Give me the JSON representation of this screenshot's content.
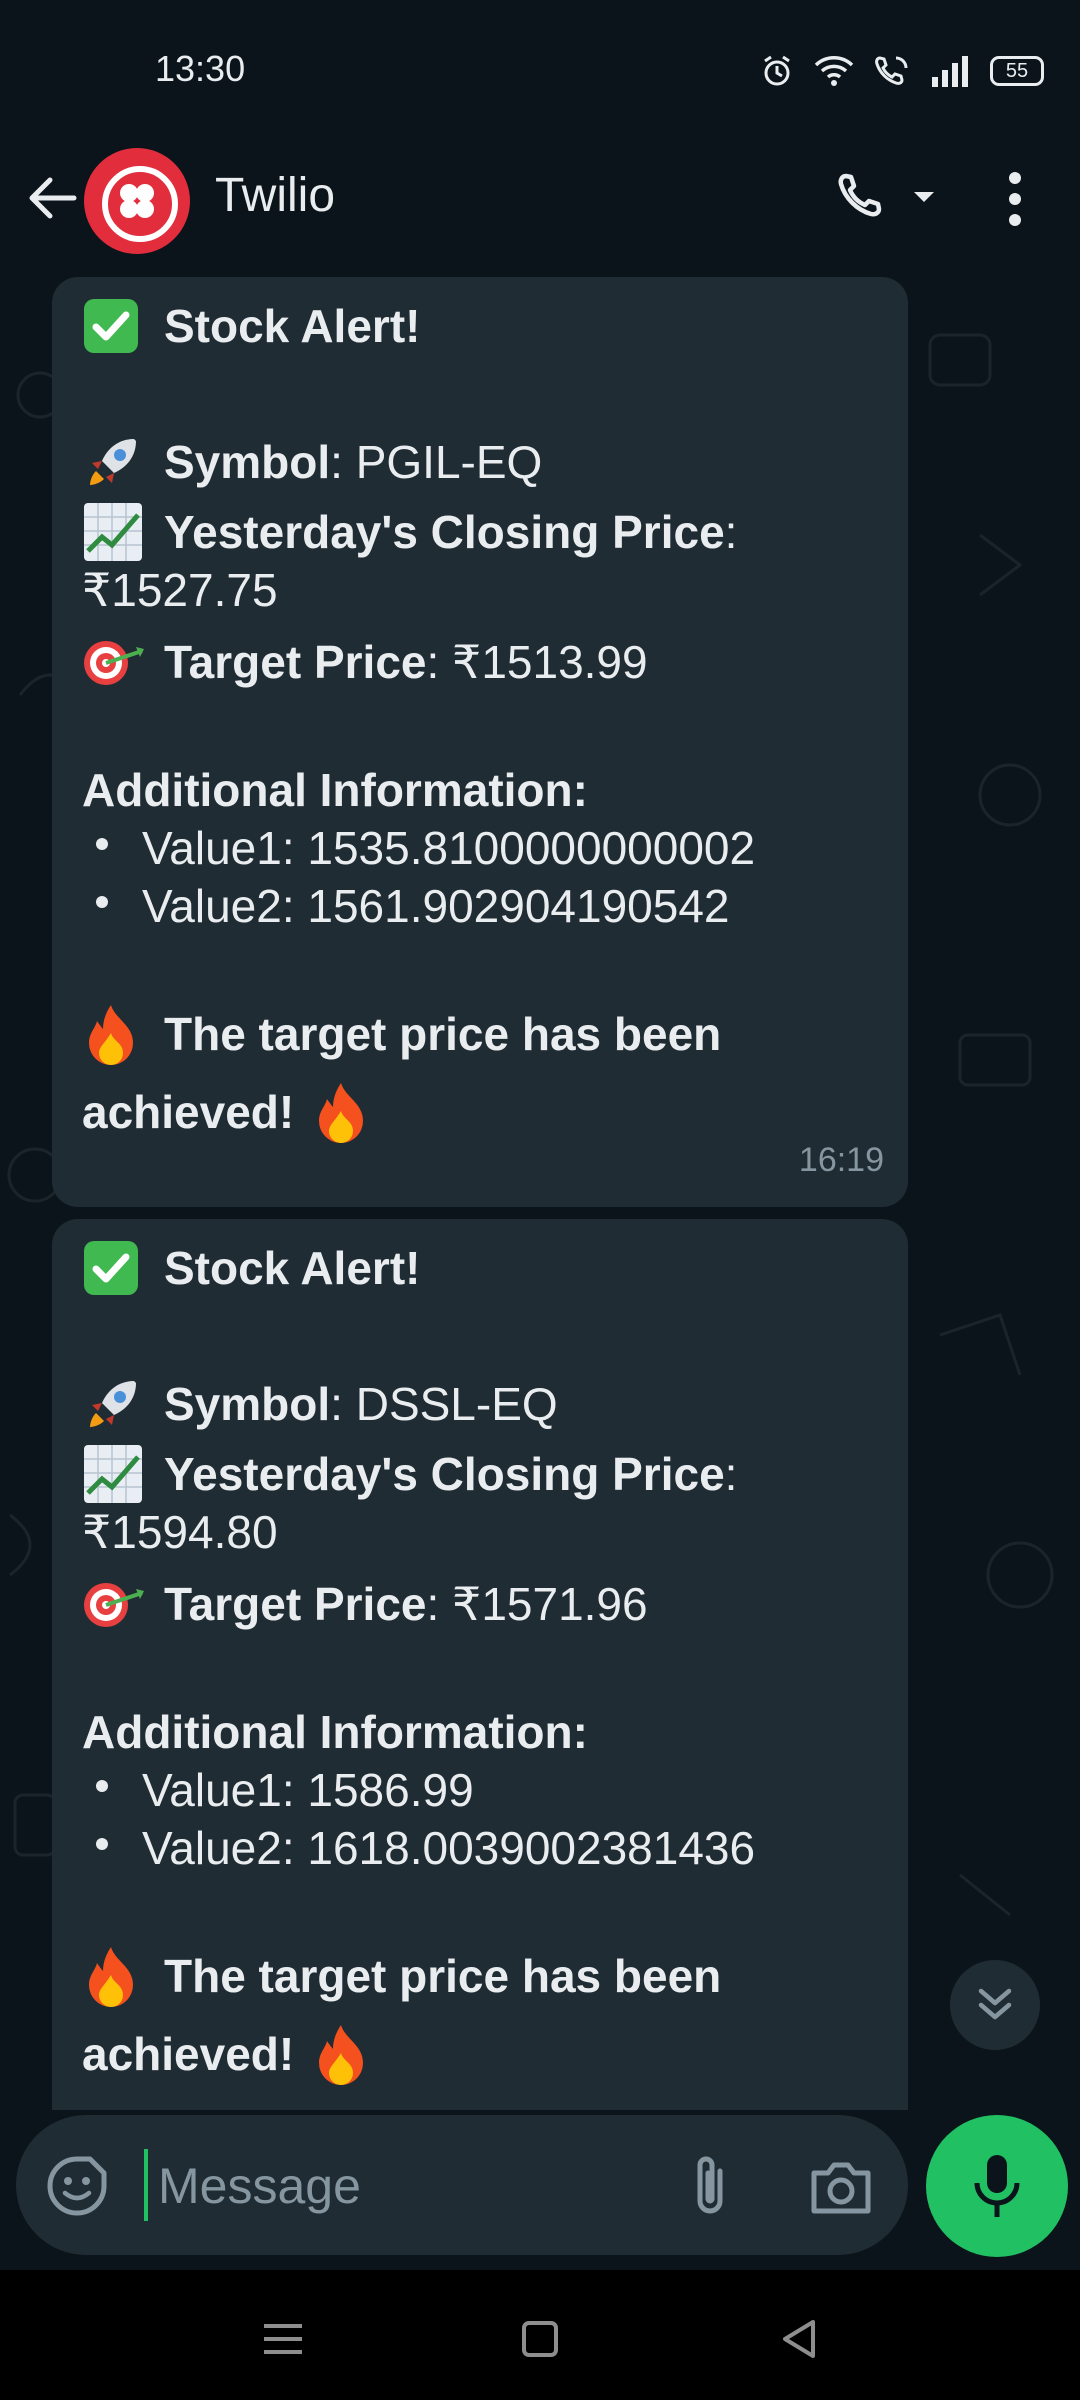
{
  "status": {
    "time": "13:30",
    "battery": "55"
  },
  "header": {
    "title": "Twilio"
  },
  "messages": [
    {
      "heading": "Stock Alert!",
      "symbol_label": "Symbol",
      "symbol": "PGIL-EQ",
      "closing_label": "Yesterday's Closing Price",
      "closing_value": "₹1527.75",
      "target_label": "Target Price",
      "target_value": "₹1513.99",
      "info_heading": "Additional Information:",
      "value1": "Value1: 1535.8100000000002",
      "value2": "Value2: 1561.902904190542",
      "achieved_1": "The target price has been",
      "achieved_2": "achieved!",
      "time": "16:19"
    },
    {
      "heading": "Stock Alert!",
      "symbol_label": "Symbol",
      "symbol": "DSSL-EQ",
      "closing_label": "Yesterday's Closing Price",
      "closing_value": "₹1594.80",
      "target_label": "Target Price",
      "target_value": "₹1571.96",
      "info_heading": "Additional Information:",
      "value1": "Value1: 1586.99",
      "value2": "Value2: 1618.0039002381436",
      "achieved_1": "The target price has been",
      "achieved_2": "achieved!"
    }
  ],
  "composer": {
    "placeholder": "Message"
  },
  "colors": {
    "accent": "#21c063",
    "bubble": "#202c33",
    "background": "#0b141a"
  }
}
